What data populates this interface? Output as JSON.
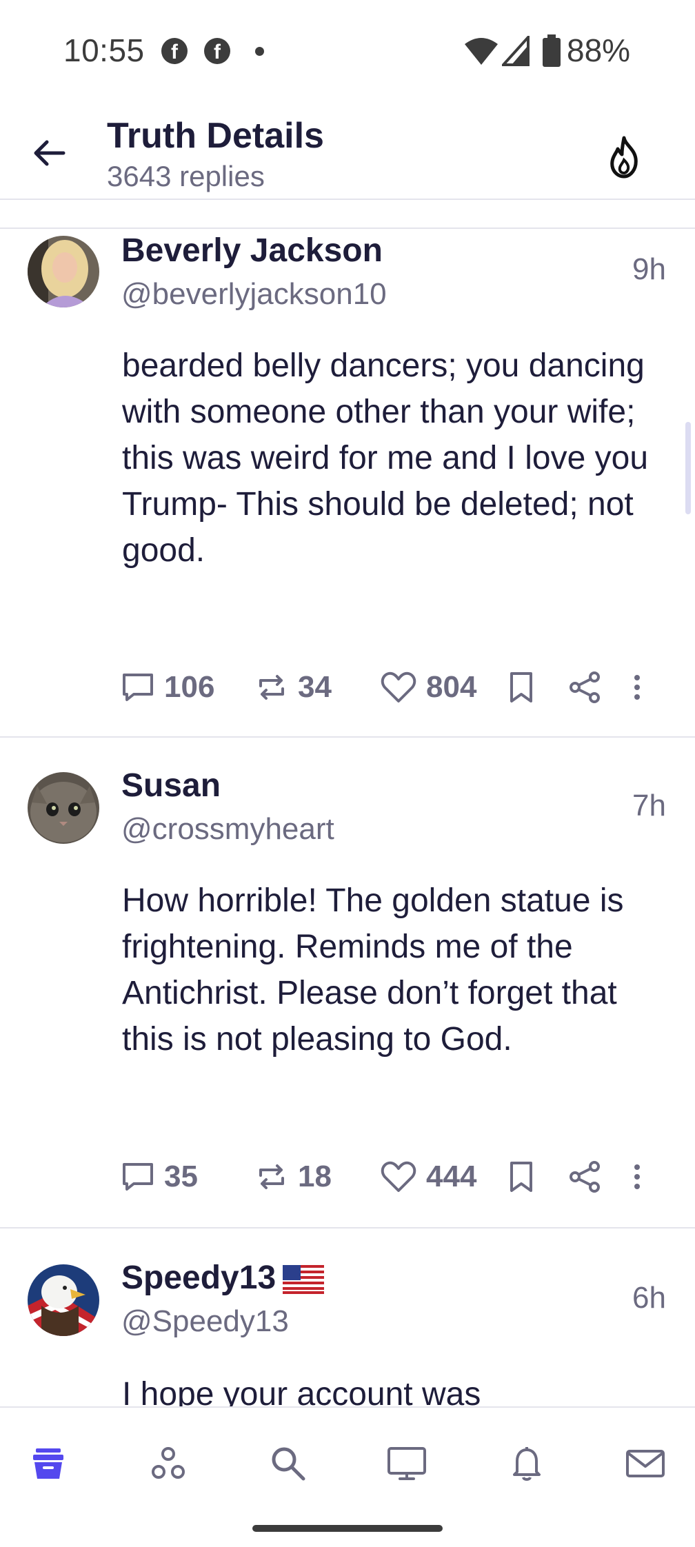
{
  "status_bar": {
    "time": "10:55",
    "battery": "88%",
    "fb_glyph": "f"
  },
  "header": {
    "title": "Truth Details",
    "subtitle": "3643 replies"
  },
  "posts": [
    {
      "name": "Beverly Jackson",
      "handle": "@beverlyjackson10",
      "time": "9h",
      "body": "bearded belly dancers; you dancing with someone other than your wife; this was weird for me and I love you Trump- This should be deleted; not good.",
      "replies": "106",
      "retruths": "34",
      "likes": "804"
    },
    {
      "name": "Susan",
      "handle": "@crossmyheart",
      "time": "7h",
      "body": "How horrible! The golden statue is frightening. Reminds me of the Antichrist. Please don’t forget that this is not pleasing to God.",
      "replies": "35",
      "retruths": "18",
      "likes": "444"
    },
    {
      "name": "Speedy13",
      "handle": "@Speedy13",
      "time": "6h",
      "body": "I hope your account was"
    }
  ],
  "nav": {
    "items": [
      "home-icon",
      "groups-icon",
      "search-icon",
      "tv-icon",
      "notifications-icon",
      "messages-icon"
    ],
    "active_color": "#5448ee"
  },
  "colors": {
    "text": "#1e1d3a",
    "muted": "#6b6a80",
    "accent": "#5448ee",
    "divider": "#e4e4ec"
  }
}
